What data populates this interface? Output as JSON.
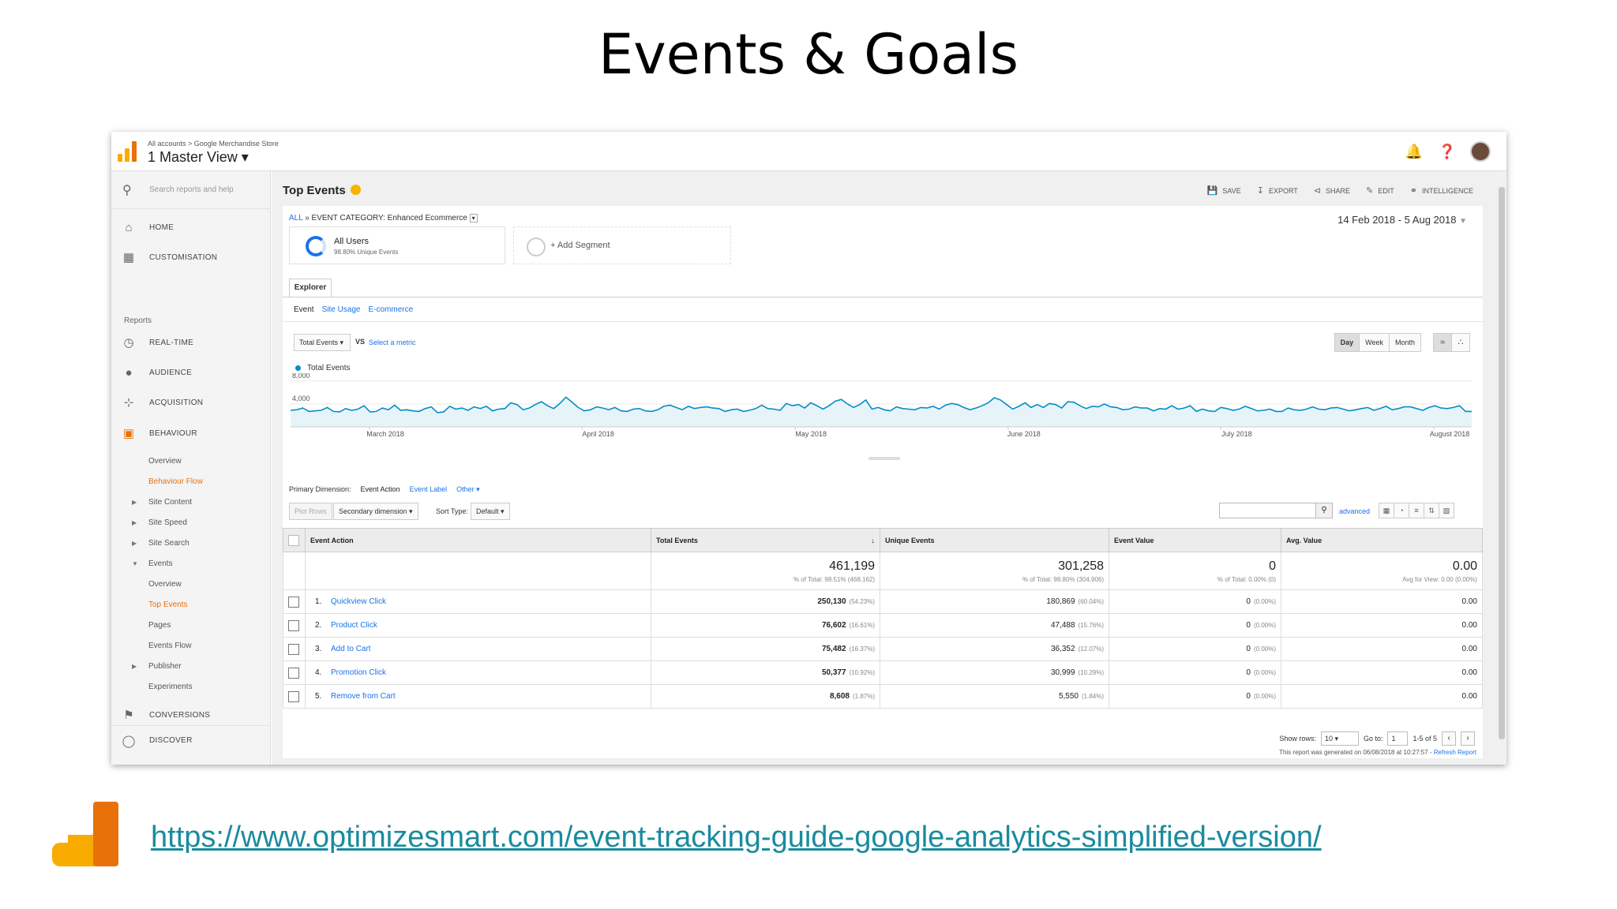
{
  "slide": {
    "title": "Events & Goals",
    "link": "https://www.optimizesmart.com/event-tracking-guide-google-analytics-simplified-version/"
  },
  "header": {
    "breadcrumb": "All accounts > Google Merchandise Store",
    "view": "1 Master View ▾"
  },
  "sidebar": {
    "search_placeholder": "Search reports and help",
    "home": "HOME",
    "customisation": "CUSTOMISATION",
    "reports_label": "Reports",
    "realtime": "REAL-TIME",
    "audience": "AUDIENCE",
    "acquisition": "ACQUISITION",
    "behaviour": "BEHAVIOUR",
    "behaviour_items": [
      "Overview",
      "Behaviour Flow",
      "Site Content",
      "Site Speed",
      "Site Search",
      "Events",
      "Overview",
      "Top Events",
      "Pages",
      "Events Flow",
      "Publisher",
      "Experiments"
    ],
    "conversions": "CONVERSIONS",
    "discover": "DISCOVER"
  },
  "toolbar": {
    "title": "Top Events",
    "save": "SAVE",
    "export": "EXPORT",
    "share": "SHARE",
    "edit": "EDIT",
    "intelligence": "INTELLIGENCE"
  },
  "report": {
    "crumb_all": "ALL",
    "crumb_sep": "»",
    "crumb_category": "EVENT CATEGORY: Enhanced Ecommerce",
    "date_range": "14 Feb 2018 - 5 Aug 2018",
    "segment_name": "All Users",
    "segment_sub": "98.80% Unique Events",
    "add_segment": "+ Add Segment",
    "tab_explorer": "Explorer",
    "subtabs": [
      "Event",
      "Site Usage",
      "E-commerce"
    ],
    "metric": "Total Events",
    "vs": "VS",
    "select_metric": "Select a metric",
    "periods": [
      "Day",
      "Week",
      "Month"
    ],
    "legend": "Total Events",
    "primary_dimension_label": "Primary Dimension:",
    "primary_dimension": "Event Action",
    "event_label": "Event Label",
    "other": "Other ▾",
    "plot_rows": "Plot Rows",
    "secondary_dimension": "Secondary dimension ▾",
    "sort_type_label": "Sort Type:",
    "sort_type": "Default ▾",
    "advanced": "advanced"
  },
  "chart_data": {
    "type": "line",
    "series": [
      {
        "name": "Total Events"
      }
    ],
    "yticks": [
      "8,000",
      "4,000"
    ],
    "xticks": [
      "March 2018",
      "April 2018",
      "May 2018",
      "June 2018",
      "July 2018",
      "August 2018"
    ],
    "ylim": [
      0,
      8000
    ],
    "color": "#058dc7",
    "values": [
      2900,
      3000,
      3300,
      2700,
      2800,
      2900,
      3400,
      2700,
      2600,
      3200,
      2900,
      3100,
      3700,
      2600,
      2700,
      3300,
      3000,
      3800,
      2900,
      3000,
      2800,
      2700,
      3200,
      3500,
      2500,
      2600,
      3600,
      3100,
      3300,
      2900,
      3500,
      3200,
      3600,
      2800,
      3100,
      3200,
      4200,
      3900,
      3000,
      3300,
      3900,
      4400,
      3700,
      3200,
      4100,
      5200,
      4300,
      3400,
      2800,
      3000,
      3500,
      3300,
      3000,
      3400,
      2800,
      2700,
      3100,
      3200,
      2800,
      2700,
      3000,
      3600,
      3800,
      3400,
      3000,
      3600,
      3200,
      3400,
      3500,
      3300,
      3200,
      2700,
      3000,
      3100,
      2700,
      2900,
      3200,
      3800,
      3200,
      3100,
      2900,
      4100,
      3700,
      3900,
      3300,
      4200,
      3700,
      3100,
      3700,
      4500,
      4800,
      4000,
      3400,
      3900,
      4700,
      3100,
      3400,
      3000,
      2800,
      3500,
      3200,
      3100,
      3000,
      3400,
      3300,
      3600,
      3100,
      3800,
      4100,
      3900,
      3400,
      3000,
      3300,
      3700,
      4200,
      5100,
      4700,
      3900,
      3100,
      3600,
      4200,
      3400,
      3900,
      3400,
      4100,
      3900,
      3300,
      4400,
      4300,
      3700,
      3200,
      3600,
      3500,
      4000,
      3500,
      3400,
      3000,
      3100,
      3500,
      3300,
      3300,
      2800,
      3200,
      3100,
      3700,
      3100,
      3300,
      3700,
      2700,
      3100,
      2800,
      2700,
      3400,
      3200,
      2900,
      3100,
      3600,
      3200,
      2800,
      2900,
      3100,
      2700,
      2700,
      3300,
      3000,
      2900,
      3100,
      3500,
      3100,
      3000,
      3300,
      3400,
      3100,
      2800,
      3000,
      3200,
      3400,
      2900,
      3200,
      3600,
      3000,
      3200,
      3500,
      3500,
      3200,
      2900,
      3400,
      3700,
      3300,
      3200,
      3400,
      3700,
      2700,
      2700
    ]
  },
  "table": {
    "headers": [
      "Event Action",
      "Total Events",
      "Unique Events",
      "Event Value",
      "Avg. Value"
    ],
    "totals": {
      "total_events": "461,199",
      "total_events_sub": "% of Total: 98.51% (468,162)",
      "unique_events": "301,258",
      "unique_events_sub": "% of Total: 98.80% (304,906)",
      "event_value": "0",
      "event_value_sub": "% of Total: 0.00% (0)",
      "avg_value": "0.00",
      "avg_value_sub": "Avg for View: 0.00 (0.00%)"
    },
    "rows": [
      {
        "n": "1.",
        "action": "Quickview Click",
        "total": "250,130",
        "total_pct": "(54.23%)",
        "unique": "180,869",
        "unique_pct": "(60.04%)",
        "value": "0",
        "value_pct": "(0.00%)",
        "avg": "0.00"
      },
      {
        "n": "2.",
        "action": "Product Click",
        "total": "76,602",
        "total_pct": "(16.61%)",
        "unique": "47,488",
        "unique_pct": "(15.76%)",
        "value": "0",
        "value_pct": "(0.00%)",
        "avg": "0.00"
      },
      {
        "n": "3.",
        "action": "Add to Cart",
        "total": "75,482",
        "total_pct": "(16.37%)",
        "unique": "36,352",
        "unique_pct": "(12.07%)",
        "value": "0",
        "value_pct": "(0.00%)",
        "avg": "0.00"
      },
      {
        "n": "4.",
        "action": "Promotion Click",
        "total": "50,377",
        "total_pct": "(10.92%)",
        "unique": "30,999",
        "unique_pct": "(10.29%)",
        "value": "0",
        "value_pct": "(0.00%)",
        "avg": "0.00"
      },
      {
        "n": "5.",
        "action": "Remove from Cart",
        "total": "8,608",
        "total_pct": "(1.87%)",
        "unique": "5,550",
        "unique_pct": "(1.84%)",
        "value": "0",
        "value_pct": "(0.00%)",
        "avg": "0.00"
      }
    ]
  },
  "pagination": {
    "show_rows_label": "Show rows:",
    "show_rows": "10",
    "goto_label": "Go to:",
    "goto": "1",
    "range": "1-5 of 5",
    "generated": "This report was generated on 06/08/2018 at 10:27:57 - ",
    "refresh": "Refresh Report"
  },
  "colors": {
    "accent": "#e8710a",
    "link": "#1a73e8",
    "line": "#058dc7",
    "footer_link": "#1a8b9f"
  }
}
